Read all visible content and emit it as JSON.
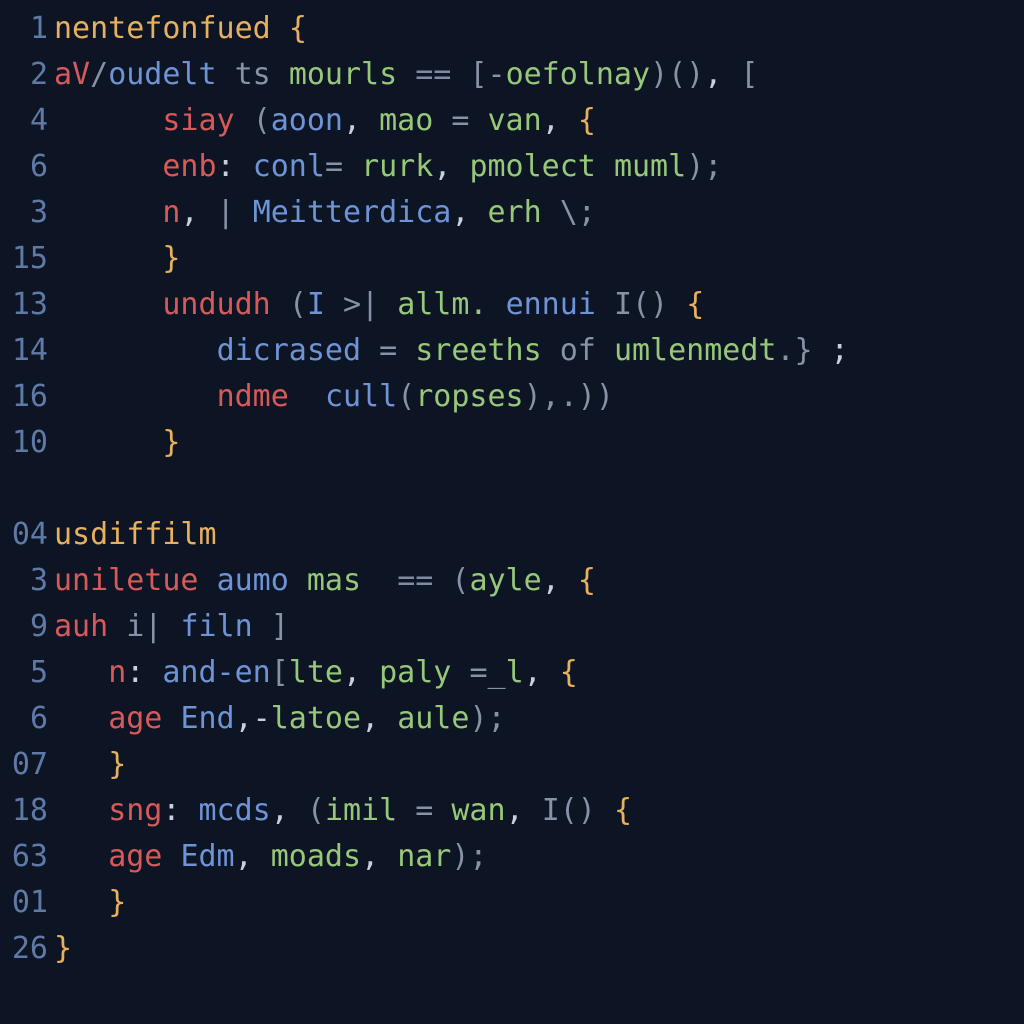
{
  "editor": {
    "lines": [
      {
        "num": "1",
        "indent": 0,
        "tokens": [
          {
            "c": "kw",
            "t": "nentefonfued"
          },
          {
            "c": "pun",
            "t": " "
          },
          {
            "c": "brace",
            "t": "{"
          }
        ]
      },
      {
        "num": "2",
        "indent": 0,
        "tokens": [
          {
            "c": "red",
            "t": "aV"
          },
          {
            "c": "gry",
            "t": "/"
          },
          {
            "c": "blu",
            "t": "oudelt"
          },
          {
            "c": "pun",
            "t": " "
          },
          {
            "c": "gry",
            "t": "ts"
          },
          {
            "c": "pun",
            "t": " "
          },
          {
            "c": "grn",
            "t": "mourls"
          },
          {
            "c": "pun",
            "t": " "
          },
          {
            "c": "op",
            "t": "=="
          },
          {
            "c": "pun",
            "t": " "
          },
          {
            "c": "gry",
            "t": "[-"
          },
          {
            "c": "grn",
            "t": "oefolnay"
          },
          {
            "c": "gry",
            "t": ")()"
          },
          {
            "c": "pun",
            "t": ","
          },
          {
            "c": "pun",
            "t": " "
          },
          {
            "c": "gry",
            "t": "["
          }
        ]
      },
      {
        "num": "4",
        "indent": 2,
        "tokens": [
          {
            "c": "red",
            "t": "siay"
          },
          {
            "c": "pun",
            "t": " "
          },
          {
            "c": "gry",
            "t": "("
          },
          {
            "c": "blu",
            "t": "aoon"
          },
          {
            "c": "pun",
            "t": ", "
          },
          {
            "c": "grn",
            "t": "mao"
          },
          {
            "c": "pun",
            "t": " "
          },
          {
            "c": "gry",
            "t": "="
          },
          {
            "c": "pun",
            "t": " "
          },
          {
            "c": "grn",
            "t": "van"
          },
          {
            "c": "pun",
            "t": ", "
          },
          {
            "c": "brace",
            "t": "{"
          }
        ]
      },
      {
        "num": "6",
        "indent": 2,
        "tokens": [
          {
            "c": "red",
            "t": "enb"
          },
          {
            "c": "pun",
            "t": ": "
          },
          {
            "c": "blu",
            "t": "conl"
          },
          {
            "c": "gry",
            "t": "= "
          },
          {
            "c": "grn",
            "t": "rurk"
          },
          {
            "c": "pun",
            "t": ", "
          },
          {
            "c": "grn",
            "t": "pmolect"
          },
          {
            "c": "pun",
            "t": " "
          },
          {
            "c": "grn",
            "t": "muml"
          },
          {
            "c": "gry",
            "t": ");"
          }
        ]
      },
      {
        "num": "3",
        "indent": 2,
        "tokens": [
          {
            "c": "red",
            "t": "n"
          },
          {
            "c": "pun",
            "t": ", "
          },
          {
            "c": "gry",
            "t": "|"
          },
          {
            "c": "pun",
            "t": " "
          },
          {
            "c": "blu",
            "t": "Meitterdica"
          },
          {
            "c": "pun",
            "t": ", "
          },
          {
            "c": "grn",
            "t": "erh"
          },
          {
            "c": "gry",
            "t": " \\;"
          }
        ]
      },
      {
        "num": "15",
        "indent": 2,
        "tokens": [
          {
            "c": "brace",
            "t": "}"
          }
        ]
      },
      {
        "num": "13",
        "indent": 2,
        "tokens": [
          {
            "c": "red",
            "t": "undudh"
          },
          {
            "c": "pun",
            "t": " "
          },
          {
            "c": "gry",
            "t": "("
          },
          {
            "c": "blu",
            "t": "I"
          },
          {
            "c": "pun",
            "t": " "
          },
          {
            "c": "gry",
            "t": ">|"
          },
          {
            "c": "pun",
            "t": " "
          },
          {
            "c": "grn",
            "t": "allm."
          },
          {
            "c": "pun",
            "t": " "
          },
          {
            "c": "blu",
            "t": "ennui"
          },
          {
            "c": "pun",
            "t": " "
          },
          {
            "c": "gry",
            "t": "I"
          },
          {
            "c": "gry",
            "t": "()"
          },
          {
            "c": "pun",
            "t": " "
          },
          {
            "c": "brace",
            "t": "{"
          }
        ]
      },
      {
        "num": "14",
        "indent": 3,
        "tokens": [
          {
            "c": "blu",
            "t": "dicrased"
          },
          {
            "c": "pun",
            "t": " "
          },
          {
            "c": "gry",
            "t": "="
          },
          {
            "c": "pun",
            "t": " "
          },
          {
            "c": "grn",
            "t": "sreeths"
          },
          {
            "c": "pun",
            "t": " "
          },
          {
            "c": "gry",
            "t": "of"
          },
          {
            "c": "pun",
            "t": " "
          },
          {
            "c": "grn",
            "t": "umlenmedt"
          },
          {
            "c": "gry",
            "t": ".}"
          },
          {
            "c": "pun",
            "t": " ;"
          }
        ]
      },
      {
        "num": "16",
        "indent": 3,
        "tokens": [
          {
            "c": "red",
            "t": "ndme"
          },
          {
            "c": "pun",
            "t": "  "
          },
          {
            "c": "blu",
            "t": "cull"
          },
          {
            "c": "gry",
            "t": "("
          },
          {
            "c": "grn",
            "t": "ropses"
          },
          {
            "c": "gry",
            "t": "),.))"
          }
        ]
      },
      {
        "num": "10",
        "indent": 2,
        "tokens": [
          {
            "c": "brace",
            "t": "}"
          }
        ]
      },
      {
        "blank": true
      },
      {
        "num": "04",
        "indent": 0,
        "tokens": [
          {
            "c": "kw",
            "t": "usdiffilm"
          }
        ]
      },
      {
        "num": "3",
        "indent": 0,
        "tokens": [
          {
            "c": "red",
            "t": "uniletue"
          },
          {
            "c": "pun",
            "t": " "
          },
          {
            "c": "blu",
            "t": "aumo"
          },
          {
            "c": "pun",
            "t": " "
          },
          {
            "c": "grn",
            "t": "mas"
          },
          {
            "c": "pun",
            "t": "  "
          },
          {
            "c": "op",
            "t": "=="
          },
          {
            "c": "pun",
            "t": " "
          },
          {
            "c": "gry",
            "t": "("
          },
          {
            "c": "grn",
            "t": "ayle"
          },
          {
            "c": "pun",
            "t": ", "
          },
          {
            "c": "brace",
            "t": "{"
          }
        ]
      },
      {
        "num": "9",
        "indent": 0,
        "tokens": [
          {
            "c": "red",
            "t": "auh"
          },
          {
            "c": "pun",
            "t": " "
          },
          {
            "c": "gry",
            "t": "i|"
          },
          {
            "c": "pun",
            "t": " "
          },
          {
            "c": "blu",
            "t": "filn"
          },
          {
            "c": "pun",
            "t": " "
          },
          {
            "c": "gry",
            "t": "]"
          }
        ]
      },
      {
        "num": "5",
        "indent": 1,
        "tokens": [
          {
            "c": "red",
            "t": "n"
          },
          {
            "c": "pun",
            "t": ": "
          },
          {
            "c": "blu",
            "t": "and-en"
          },
          {
            "c": "gry",
            "t": "["
          },
          {
            "c": "grn",
            "t": "lte"
          },
          {
            "c": "pun",
            "t": ", "
          },
          {
            "c": "grn",
            "t": "paly"
          },
          {
            "c": "pun",
            "t": " "
          },
          {
            "c": "gry",
            "t": "=_"
          },
          {
            "c": "grn",
            "t": "l"
          },
          {
            "c": "pun",
            "t": ", "
          },
          {
            "c": "brace",
            "t": "{"
          }
        ]
      },
      {
        "num": "6",
        "indent": 1,
        "tokens": [
          {
            "c": "red",
            "t": "age"
          },
          {
            "c": "pun",
            "t": " "
          },
          {
            "c": "blu",
            "t": "End"
          },
          {
            "c": "pun",
            "t": ",-"
          },
          {
            "c": "grn",
            "t": "latoe"
          },
          {
            "c": "pun",
            "t": ", "
          },
          {
            "c": "grn",
            "t": "aule"
          },
          {
            "c": "gry",
            "t": ");"
          }
        ]
      },
      {
        "num": "07",
        "indent": 1,
        "tokens": [
          {
            "c": "brace",
            "t": "}"
          }
        ]
      },
      {
        "num": "18",
        "indent": 1,
        "tokens": [
          {
            "c": "red",
            "t": "sng"
          },
          {
            "c": "pun",
            "t": ": "
          },
          {
            "c": "blu",
            "t": "mcds"
          },
          {
            "c": "pun",
            "t": ", "
          },
          {
            "c": "gry",
            "t": "("
          },
          {
            "c": "grn",
            "t": "imil"
          },
          {
            "c": "pun",
            "t": " "
          },
          {
            "c": "gry",
            "t": "="
          },
          {
            "c": "pun",
            "t": " "
          },
          {
            "c": "grn",
            "t": "wan"
          },
          {
            "c": "pun",
            "t": ", "
          },
          {
            "c": "gry",
            "t": "I()"
          },
          {
            "c": "pun",
            "t": " "
          },
          {
            "c": "brace",
            "t": "{"
          }
        ]
      },
      {
        "num": "63",
        "indent": 1,
        "tokens": [
          {
            "c": "red",
            "t": "age"
          },
          {
            "c": "pun",
            "t": " "
          },
          {
            "c": "blu",
            "t": "Edm"
          },
          {
            "c": "pun",
            "t": ", "
          },
          {
            "c": "grn",
            "t": "moads"
          },
          {
            "c": "pun",
            "t": ", "
          },
          {
            "c": "grn",
            "t": "nar"
          },
          {
            "c": "gry",
            "t": ");"
          }
        ]
      },
      {
        "num": "01",
        "indent": 1,
        "tokens": [
          {
            "c": "brace",
            "t": "}"
          }
        ]
      },
      {
        "num": "26",
        "indent": 0,
        "tokens": [
          {
            "c": "brace",
            "t": "}"
          }
        ]
      }
    ]
  }
}
